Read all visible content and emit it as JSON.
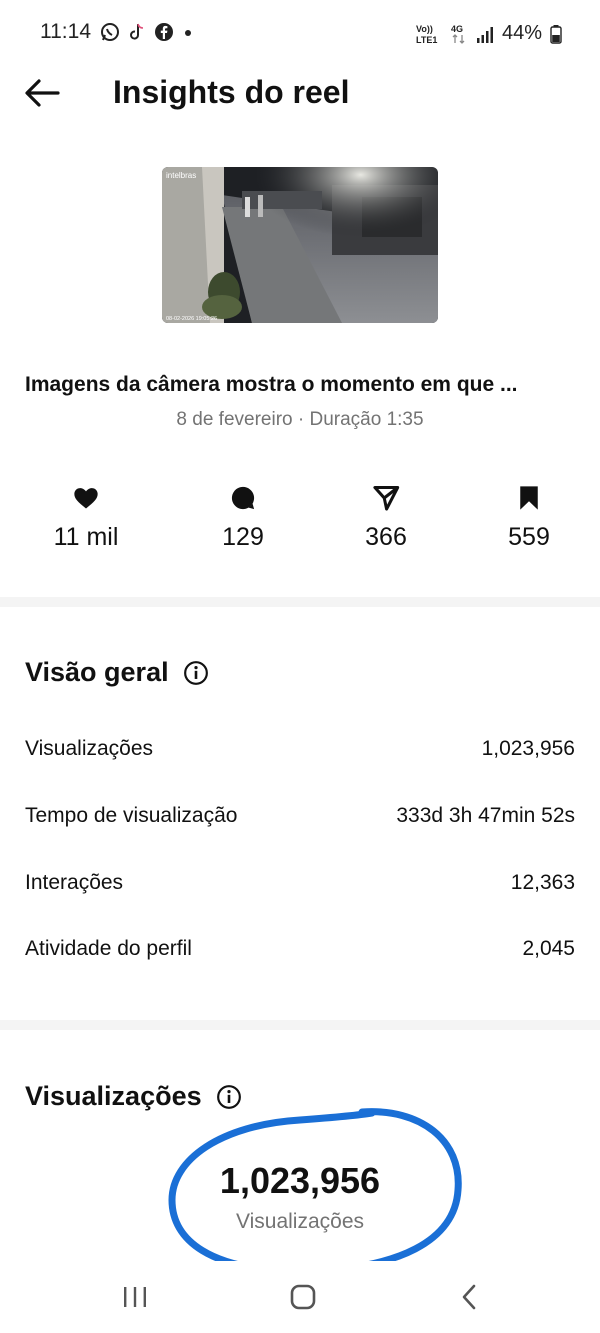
{
  "status_bar": {
    "time": "11:14",
    "battery": "44%",
    "network": "4G",
    "volte": "Vo)) LTE1",
    "icons": [
      "whatsapp-icon",
      "tiktok-icon",
      "facebook-icon",
      "notification-dot-icon",
      "signal-icon",
      "battery-icon"
    ]
  },
  "header": {
    "title": "Insights do reel",
    "back_icon": "arrow-left-icon"
  },
  "reel": {
    "thumbnail_watermark": "intelbras",
    "thumbnail_timestamp": "08-02-2026 19:05:26",
    "caption": "Imagens da câmera mostra o momento em que ...",
    "meta": "8 de fevereiro · Duração 1:35"
  },
  "stats": [
    {
      "icon": "heart-icon",
      "value": "11 mil"
    },
    {
      "icon": "comment-icon",
      "value": "129"
    },
    {
      "icon": "share-icon",
      "value": "366"
    },
    {
      "icon": "bookmark-icon",
      "value": "559"
    }
  ],
  "overview": {
    "title": "Visão geral",
    "rows": [
      {
        "label": "Visualizações",
        "value": "1,023,956"
      },
      {
        "label": "Tempo de visualização",
        "value": "333d 3h 47min 52s"
      },
      {
        "label": "Interações",
        "value": "12,363"
      },
      {
        "label": "Atividade do perfil",
        "value": "2,045"
      }
    ]
  },
  "views_section": {
    "title": "Visualizações",
    "total": "1,023,956",
    "label": "Visualizações",
    "highlight_color": "#1a6fd6"
  },
  "nav": {
    "recents_icon": "recents-icon",
    "home_icon": "home-icon",
    "back_icon": "back-chevron-icon"
  },
  "colors": {
    "text": "#111111",
    "muted": "#737373",
    "divider": "#f4f4f4"
  }
}
